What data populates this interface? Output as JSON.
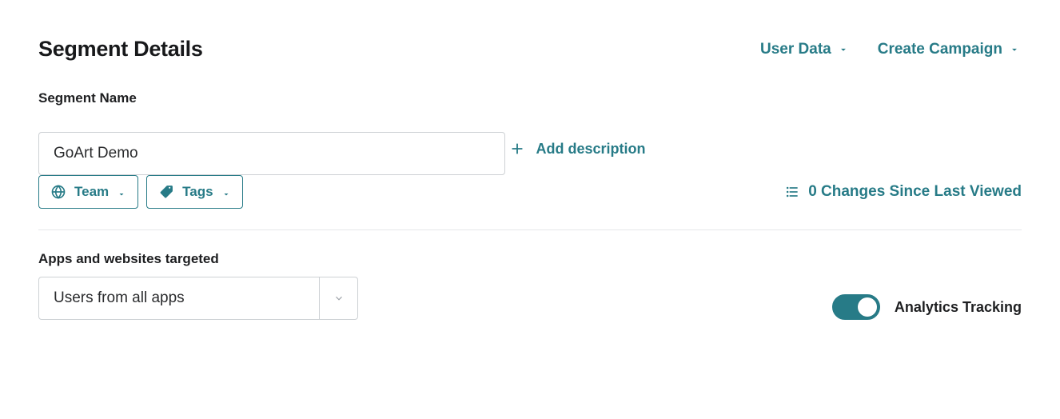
{
  "header": {
    "title": "Segment Details",
    "actions": {
      "user_data": "User Data",
      "create_campaign": "Create Campaign"
    }
  },
  "segment": {
    "name_label": "Segment Name",
    "name_value": "GoArt Demo",
    "add_description": "Add description",
    "team_label": "Team",
    "tags_label": "Tags",
    "changes_label": "0 Changes Since Last Viewed"
  },
  "apps": {
    "label": "Apps and websites targeted",
    "selection": "Users from all apps"
  },
  "analytics": {
    "label": "Analytics Tracking",
    "enabled": true
  }
}
